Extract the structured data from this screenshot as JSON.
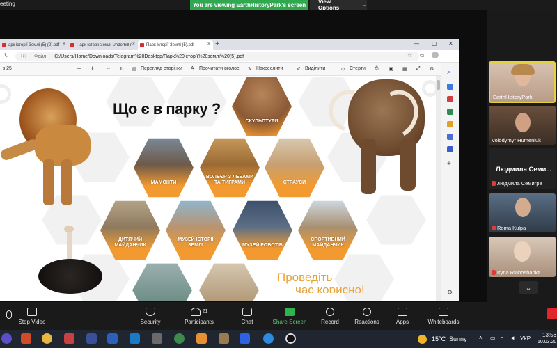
{
  "top": {
    "meeting_label": "eeting",
    "share_banner": "You are viewing EarthHistoryPark's screen",
    "view_options": "View Options"
  },
  "browser": {
    "tabs": [
      {
        "label": "арк історії Землі (5) (2).pdf"
      },
      {
        "label": "Парк Історії Землі Underhill гр.сп"
      },
      {
        "label": "Парк Історії Землі (5).pdf"
      }
    ],
    "address_label": "Файл",
    "address": "C:/Users/Home/Downloads/Telegram%20Desktop/Парк%20історії%20землі%20(5).pdf",
    "toolbar": {
      "page": "з 25",
      "minus": "—",
      "plus": "+",
      "page_view": "Перегляд сторінки",
      "read_aloud": "Прочитати вголос",
      "draw": "Накреслити",
      "highlight": "Виділити",
      "erase": "Стерти"
    }
  },
  "pdf": {
    "title": "Що є в парку ?",
    "tiles": [
      {
        "label": "СКУЛЬПТУРИ"
      },
      {
        "label": "МАМОНТИ"
      },
      {
        "label": "ВОЛЬЄР З ЛЕВАМИ ТА ТИГРАМИ"
      },
      {
        "label": "СТРАУСИ"
      },
      {
        "label": "ДИТЯЧИЙ МАЙДАНЧИК"
      },
      {
        "label": "МУЗЕЙ ІСТОРІЇ ЗЕМЛІ"
      },
      {
        "label": "МУЗЕЙ РОБОТІВ"
      },
      {
        "label": "СПОРТИВНИЙ МАЙДАНЧИК"
      }
    ],
    "footer_line1": "Проведіть",
    "footer_line2": "час корисно!"
  },
  "gallery": {
    "participants": [
      {
        "name": "EarthHistoryPark"
      },
      {
        "name": "Volodymyr Humeniuk"
      },
      {
        "name": "Людмила Семигра"
      },
      {
        "name": "Roma Kulpa"
      },
      {
        "name": "Iryna Riaboshapka"
      }
    ],
    "featured_name": "Людмила  Семи..."
  },
  "controls": {
    "stop_video": "Stop Video",
    "security": "Security",
    "participants": "Participants",
    "participants_count": "21",
    "chat": "Chat",
    "share_screen": "Share Screen",
    "record": "Record",
    "reactions": "Reactions",
    "apps": "Apps",
    "whiteboards": "Whiteboards"
  },
  "taskbar": {
    "temperature": "15°C",
    "weather": "Sunny",
    "lang": "УКР",
    "time": "13:56",
    "date": "10.03.20"
  }
}
